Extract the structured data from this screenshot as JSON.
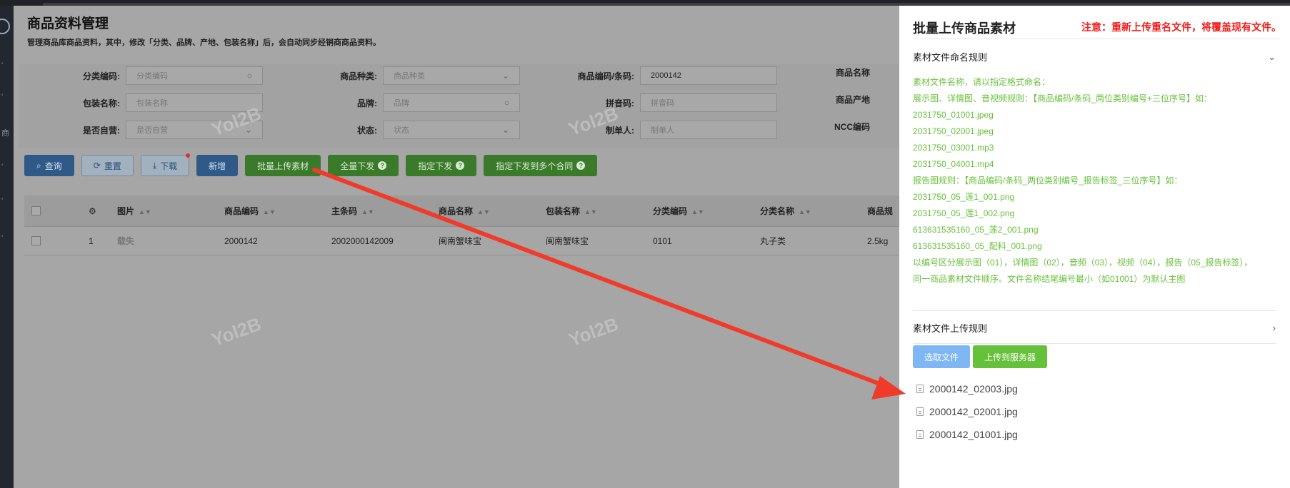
{
  "page": {
    "title": "商品资料管理",
    "description": "管理商品库商品资料，其中，修改「分类、品牌、产地、包装名称」后，会自动同步经销商商品资料。"
  },
  "sidebar": {
    "marks": [
      "商",
      "'",
      "'",
      "'",
      "'",
      "'"
    ]
  },
  "filters": {
    "row1": [
      {
        "label": "分类编码:",
        "value": "",
        "placeholder": "分类编码"
      },
      {
        "label": "商品种类:",
        "value": "",
        "placeholder": "商品种类"
      },
      {
        "label": "商品编码/条码:",
        "value": "2000142",
        "placeholder": ""
      },
      {
        "label": "商品名称",
        "value": "",
        "placeholder": ""
      }
    ],
    "row2": [
      {
        "label": "包装名称:",
        "value": "",
        "placeholder": "包装名称"
      },
      {
        "label": "品牌:",
        "value": "",
        "placeholder": "品牌"
      },
      {
        "label": "拼音码:",
        "value": "",
        "placeholder": "拼音码"
      },
      {
        "label": "商品产地",
        "value": "",
        "placeholder": ""
      }
    ],
    "row3": [
      {
        "label": "是否自营:",
        "value": "",
        "placeholder": "是否自营"
      },
      {
        "label": "状态:",
        "value": "",
        "placeholder": "状态"
      },
      {
        "label": "制单人:",
        "value": "",
        "placeholder": "制单人"
      },
      {
        "label": "NCC编码",
        "value": "",
        "placeholder": ""
      }
    ]
  },
  "toolbar": {
    "query": "查询",
    "reset": "重置",
    "download": "下载",
    "add": "新增",
    "batch_upload": "批量上传素材",
    "dispatch_all": "全量下发",
    "dispatch_specified": "指定下发",
    "dispatch_multi": "指定下发到多个合同"
  },
  "table": {
    "columns": [
      "图片",
      "商品编码",
      "主条码",
      "商品名称",
      "包装名称",
      "分类编码",
      "分类名称",
      "商品规"
    ],
    "rows": [
      {
        "index": "1",
        "image": "载失",
        "code": "2000142",
        "barcode": "2002000142009",
        "name": "闽南蟹味宝",
        "package": "闽南蟹味宝",
        "cat_code": "0101",
        "cat_name": "丸子类",
        "spec": "2.5kg"
      }
    ]
  },
  "watermarks": [
    "Yol2B",
    "Yol2B",
    "Yol2B",
    "Yol2B"
  ],
  "drawer": {
    "title": "批量上传商品素材",
    "note": "注意：重新上传重名文件，将覆盖现有文件。",
    "naming_rules_title": "素材文件命名规则",
    "naming_rules": [
      "素材文件名称，请以指定格式命名：",
      "展示图、详情图、音视频规则：【商品编码/条码_两位类别编号+三位序号】如：",
      "2031750_01001.jpeg",
      "2031750_02001.jpeg",
      "2031750_03001.mp3",
      "2031750_04001.mp4",
      "报告图规则：【商品编码/条码_两位类别编号_报告标签_三位序号】如：",
      "2031750_05_莲1_001.png",
      "2031750_05_莲1_002.png",
      "613631535160_05_莲2_001.png",
      "613631535160_05_配料_001.png",
      "以编号区分展示图（01），详情图（02），音频（03），视频（04），报告（05_报告标签），",
      "同一商品素材文件顺序。文件名称结尾编号最小（如01001）为默认主图"
    ],
    "upload_rules_title": "素材文件上传规则",
    "select_file": "选取文件",
    "upload_server": "上传到服务器",
    "files": [
      "2000142_02003.jpg",
      "2000142_02001.jpg",
      "2000142_01001.jpg"
    ]
  },
  "colors": {
    "accent_green": "#67c23a",
    "note_red": "#f21e1e",
    "primary_blue": "#409eff",
    "arrow_red": "#f03a2a"
  }
}
